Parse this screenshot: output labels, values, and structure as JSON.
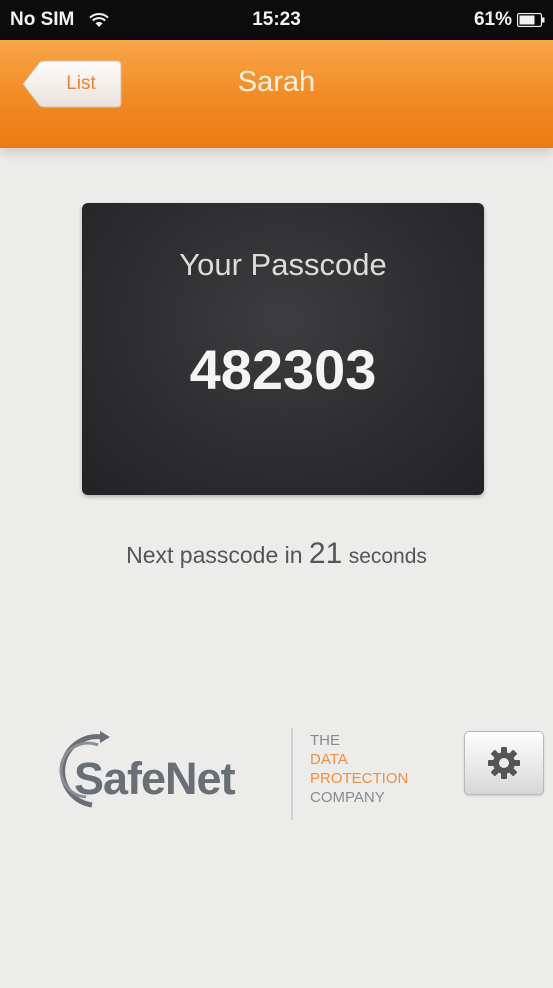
{
  "status_bar": {
    "carrier": "No SIM",
    "time": "15:23",
    "battery": "61%"
  },
  "nav": {
    "back_label": "List",
    "title": "Sarah"
  },
  "passcode": {
    "title": "Your Passcode",
    "value": "482303"
  },
  "countdown": {
    "prefix": "Next passcode in",
    "seconds": "21",
    "unit": "seconds"
  },
  "branding": {
    "logo_text": "SafeNet",
    "tagline": [
      "THE",
      "DATA",
      "PROTECTION",
      "COMPANY"
    ],
    "tagline_colors": [
      "#8a8a8a",
      "#ee8f3a",
      "#ee8f3a",
      "#8a8a8a"
    ]
  },
  "colors": {
    "accent": "#f28a22",
    "card": "#2e2e30",
    "background": "#ececea"
  },
  "icons": {
    "wifi": "wifi-icon",
    "battery": "battery-icon",
    "back": "back-arrow",
    "settings": "gear-icon"
  }
}
